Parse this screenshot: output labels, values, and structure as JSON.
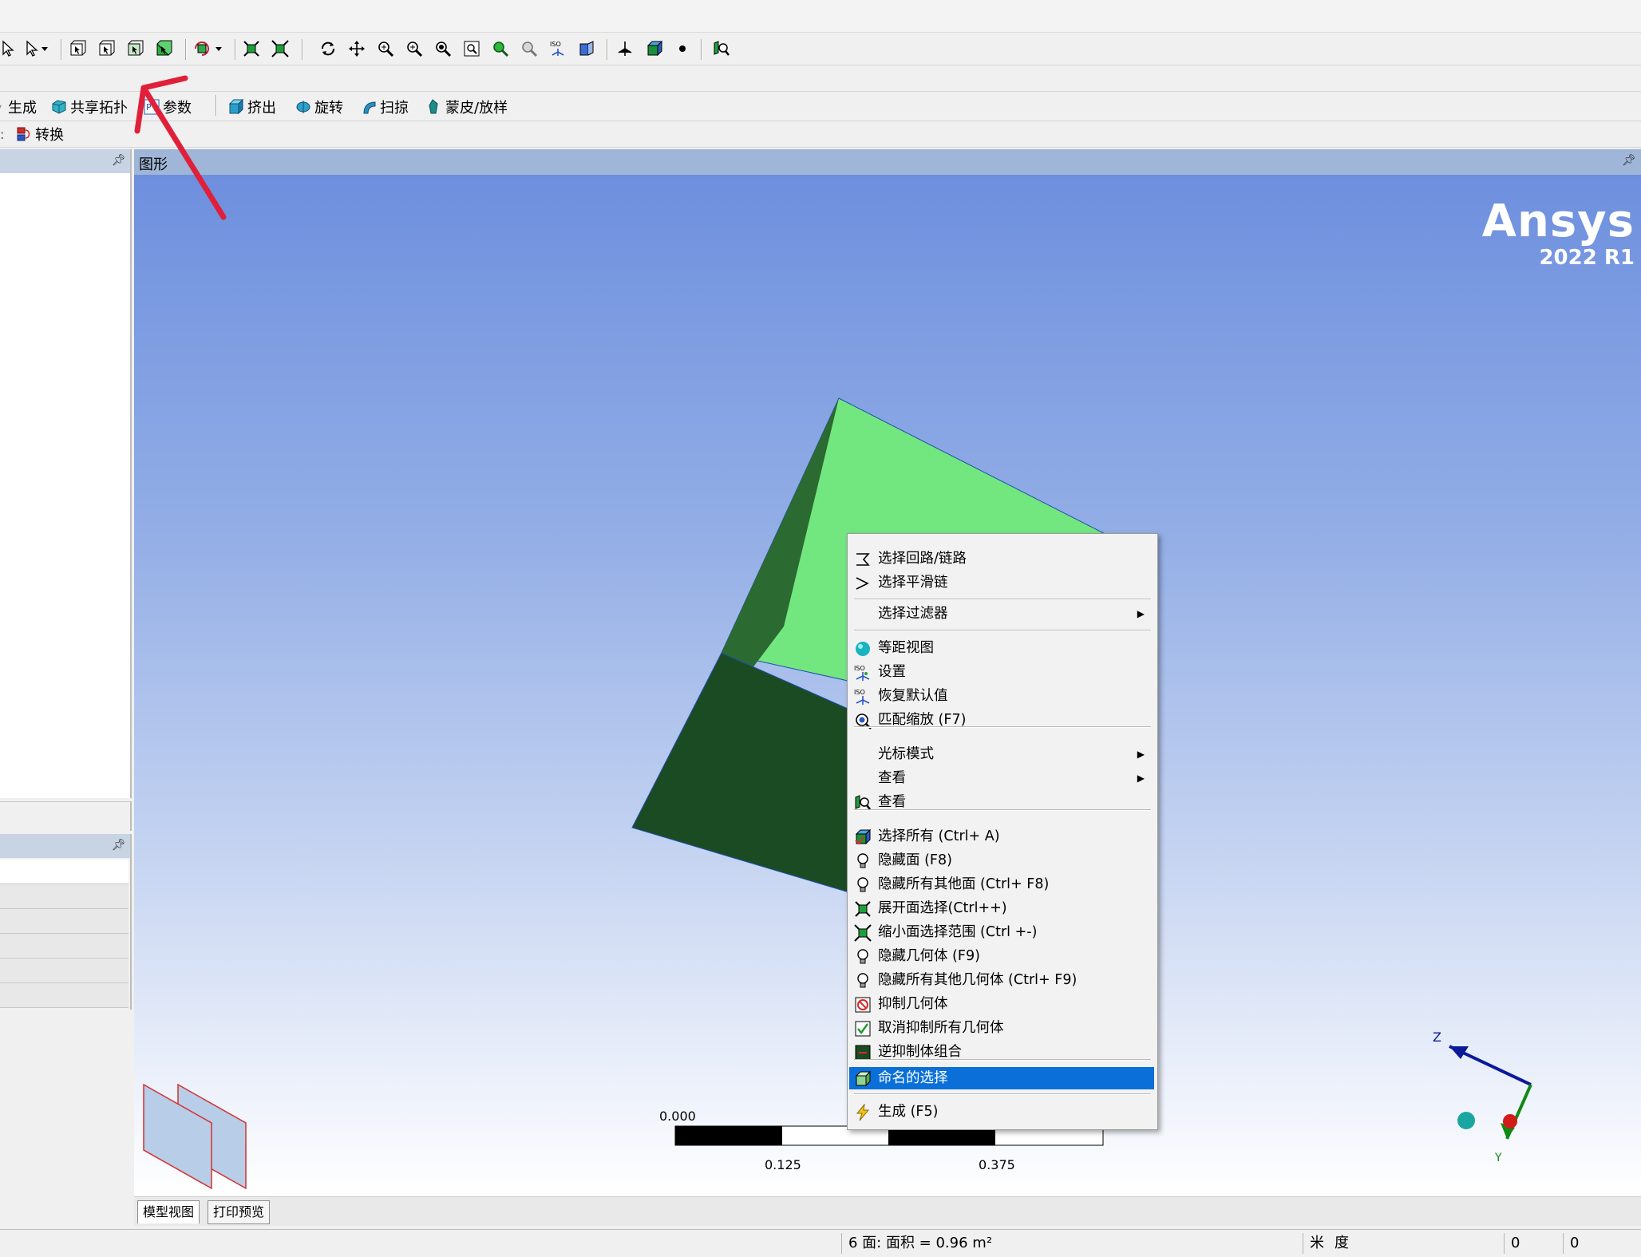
{
  "toolbar_rows": {
    "row2": [
      {
        "label": "生成",
        "icon": "generate-icon"
      },
      {
        "label": "共享拓扑",
        "icon": "share-topology-icon"
      },
      {
        "label": "参数",
        "icon": "parameters-icon"
      },
      {
        "label": "挤出",
        "icon": "extrude-icon"
      },
      {
        "label": "旋转",
        "icon": "revolve-icon"
      },
      {
        "label": "扫掠",
        "icon": "sweep-icon"
      },
      {
        "label": "蒙皮/放样",
        "icon": "skin-loft-icon"
      }
    ],
    "row3": [
      {
        "label": "转换",
        "icon": "convert-icon"
      }
    ]
  },
  "graphics": {
    "panel_title": "图形",
    "brand_name": "Ansys",
    "brand_version": "2022 R1",
    "scale_labels": [
      "0.000",
      "0.125",
      "0.375"
    ],
    "triad_labels": {
      "z": "Z",
      "y": "Y"
    }
  },
  "context_menu": {
    "items": [
      {
        "label": "选择回路/链路",
        "icon": "loop-select-icon"
      },
      {
        "label": "选择平滑链",
        "icon": "smooth-chain-icon"
      },
      {
        "label": "选择过滤器",
        "submenu": true
      },
      {
        "label": "等距视图",
        "icon": "isometric-view-icon"
      },
      {
        "label": "设置",
        "icon": "iso-settings-icon"
      },
      {
        "label": "恢复默认值",
        "icon": "iso-restore-icon"
      },
      {
        "label": "匹配缩放 (F7)",
        "icon": "zoom-to-fit-icon"
      },
      {
        "label": "光标模式",
        "submenu": true
      },
      {
        "label": "查看",
        "submenu": true
      },
      {
        "label": "查看",
        "icon": "view-icon"
      },
      {
        "label": "选择所有 (Ctrl+ A)",
        "icon": "select-all-icon"
      },
      {
        "label": "隐藏面 (F8)",
        "icon": "lightbulb-icon"
      },
      {
        "label": "隐藏所有其他面 (Ctrl+ F8)",
        "icon": "lightbulb-icon"
      },
      {
        "label": "展开面选择(Ctrl++)",
        "icon": "expand-selection-icon"
      },
      {
        "label": "缩小面选择范围 (Ctrl +-)",
        "icon": "shrink-selection-icon"
      },
      {
        "label": "隐藏几何体 (F9)",
        "icon": "lightbulb-icon"
      },
      {
        "label": "隐藏所有其他几何体 (Ctrl+ F9)",
        "icon": "lightbulb-icon"
      },
      {
        "label": "抑制几何体",
        "icon": "suppress-body-icon"
      },
      {
        "label": "取消抑制所有几何体",
        "icon": "unsuppress-all-icon"
      },
      {
        "label": "逆抑制体组合",
        "icon": "invert-suppression-icon"
      },
      {
        "label": "命名的选择",
        "icon": "named-selection-icon",
        "selected": true
      },
      {
        "label": "生成 (F5)",
        "icon": "generate-bolt-icon"
      }
    ]
  },
  "bottom_tabs": [
    "模型视图",
    "打印预览"
  ],
  "status_bar": {
    "selection_info": "6 面: 面积 = 0.96 m²",
    "unit_length": "米",
    "unit_angle": "度",
    "value1": "0",
    "value2": "0"
  },
  "colors": {
    "face_light": "#72e67f",
    "face_dark": "#1b4b22",
    "menu_highlight": "#0a6fd8",
    "annotation_arrow": "#e0203a"
  }
}
